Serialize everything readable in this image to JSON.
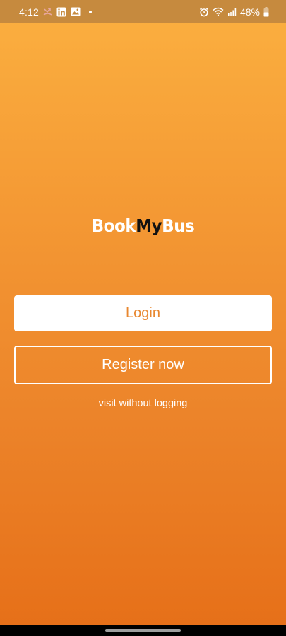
{
  "status_bar": {
    "time": "4:12",
    "battery": "48%",
    "left_icons": [
      "missed-call-icon",
      "linkedin-icon",
      "gallery-icon",
      "dot-icon"
    ],
    "right_icons": [
      "alarm-icon",
      "wifi-icon",
      "signal-icon",
      "battery-icon"
    ]
  },
  "logo": {
    "part1": "Book",
    "part2": "My",
    "part3": "Bus"
  },
  "actions": {
    "login_label": "Login",
    "register_label": "Register now",
    "visit_label": "visit without logging"
  },
  "colors": {
    "gradient_top": "#FBB040",
    "gradient_bottom": "#E66F18",
    "status_bar": "#C68A3E",
    "login_text": "#E8872F",
    "logo_accent": "#111111"
  }
}
